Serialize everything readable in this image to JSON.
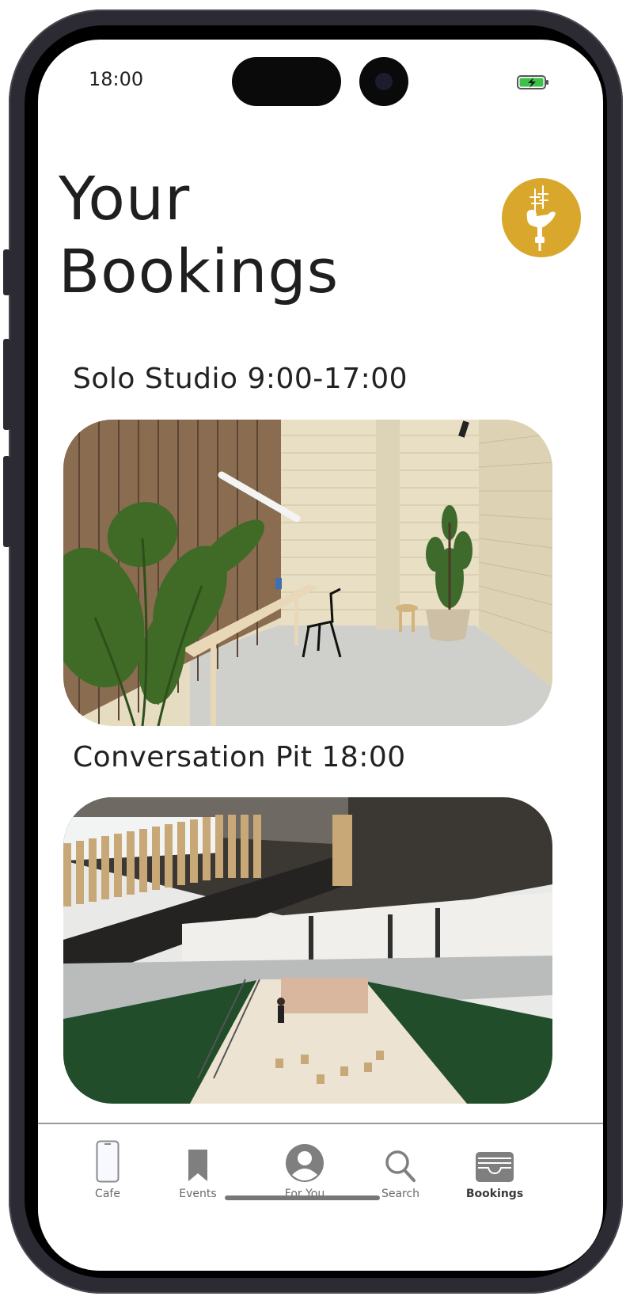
{
  "status_bar": {
    "time": "18:00",
    "battery_color": "#3ec14a"
  },
  "page": {
    "title_line1": "Your",
    "title_line2": "Bookings"
  },
  "profile": {
    "avatar_color": "#d9a72b",
    "icon": "bird-logo-icon"
  },
  "bookings": [
    {
      "label": "Solo Studio 9:00-17:00",
      "image": "solo-studio-photo"
    },
    {
      "label": "Conversation Pit 18:00",
      "image": "conversation-pit-photo"
    }
  ],
  "tabbar": {
    "items": [
      {
        "label": "Cafe",
        "icon": "phone-icon"
      },
      {
        "label": "Events",
        "icon": "bookmark-icon"
      },
      {
        "label": "For You",
        "icon": "person-icon"
      },
      {
        "label": "Search",
        "icon": "search-icon"
      },
      {
        "label": "Bookings",
        "icon": "wallet-icon",
        "active": true
      }
    ]
  }
}
